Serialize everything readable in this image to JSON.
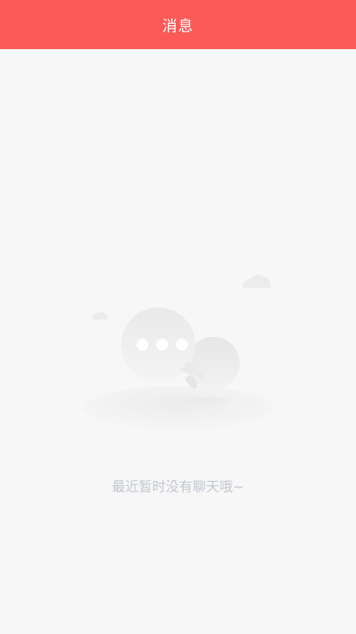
{
  "header": {
    "title": "消息"
  },
  "empty_state": {
    "message": "最近暂时没有聊天哦~",
    "illustration_icon": "chat-bubbles-icon"
  },
  "colors": {
    "header_bg": "#fb5a59",
    "page_bg": "#f7f7f7",
    "empty_text": "#c3c7cf"
  }
}
